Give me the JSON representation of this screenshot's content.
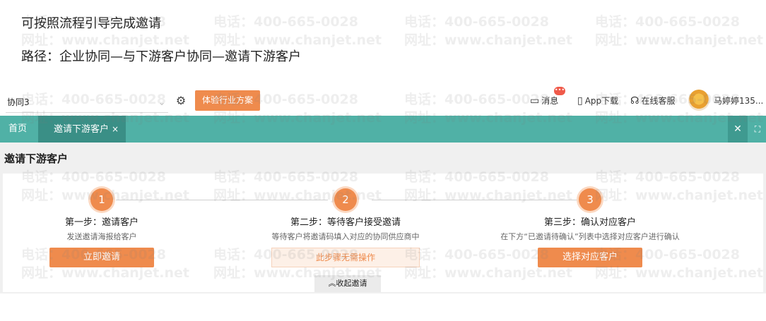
{
  "caption": {
    "line1": "可按照流程引导完成邀请",
    "line2": "路径：企业协同—与下游客户协同—邀请下游客户"
  },
  "watermark": {
    "phone": "电话：400-665-0028",
    "site": "网址：www.chanjet.net"
  },
  "toolbar": {
    "org_value": "协同3",
    "industry_button": "体验行业方案",
    "message_label": "消息",
    "message_badge": "•••",
    "app_download": "App下载",
    "online_service": "在线客服",
    "user_name": "马婷婷135..."
  },
  "tabs": {
    "home": "首页",
    "active": "邀请下游客户",
    "close_mark": "×"
  },
  "page": {
    "title": "邀请下游客户",
    "collapse_label": "收起邀请"
  },
  "steps": [
    {
      "number": "1",
      "title": "第一步：邀请客户",
      "desc": "发送邀请海报给客户",
      "action": "立即邀请"
    },
    {
      "number": "2",
      "title": "第二步：等待客户接受邀请",
      "desc": "等待客户将邀请码填入对应的协同供应商中",
      "action": "此步骤无需操作"
    },
    {
      "number": "3",
      "title": "第三步：确认对应客户",
      "desc": "在下方“已邀请待确认”列表中选择对应客户进行确认",
      "action": "选择对应客户"
    }
  ],
  "colors": {
    "accent": "#ef8b4d",
    "tabbar": "#50b1a6",
    "tab_active": "#3a8f86"
  }
}
